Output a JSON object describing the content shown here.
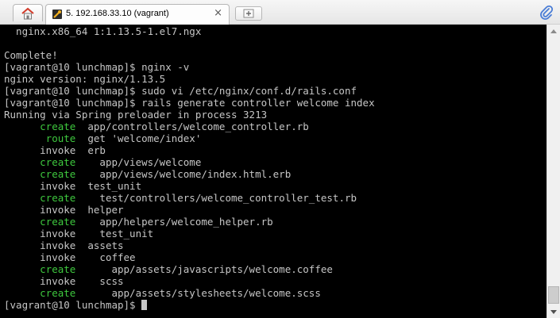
{
  "tabbar": {
    "home_icon": "home-icon",
    "tab_title": "5. 192.168.33.10 (vagrant)",
    "tab_icon": "tools-icon",
    "close_glyph": "×",
    "new_tab_icon": "new-tab-icon",
    "attach_icon": "paperclip-icon"
  },
  "terminal": {
    "lines": [
      {
        "text": "  nginx.x86_64 1:1.13.5-1.el7.ngx"
      },
      {
        "text": ""
      },
      {
        "text": "Complete!"
      },
      {
        "text": "[vagrant@10 lunchmap]$ nginx -v"
      },
      {
        "text": "nginx version: nginx/1.13.5"
      },
      {
        "text": "[vagrant@10 lunchmap]$ sudo vi /etc/nginx/conf.d/rails.conf"
      },
      {
        "text": "[vagrant@10 lunchmap]$ rails generate controller welcome index"
      },
      {
        "text": "Running via Spring preloader in process 3213"
      },
      {
        "action": "      create",
        "text": "  app/controllers/welcome_controller.rb"
      },
      {
        "action": "       route",
        "text": "  get 'welcome/index'"
      },
      {
        "action": "      invoke",
        "text": "  erb",
        "plain": true
      },
      {
        "action": "      create",
        "text": "    app/views/welcome"
      },
      {
        "action": "      create",
        "text": "    app/views/welcome/index.html.erb"
      },
      {
        "action": "      invoke",
        "text": "  test_unit",
        "plain": true
      },
      {
        "action": "      create",
        "text": "    test/controllers/welcome_controller_test.rb"
      },
      {
        "action": "      invoke",
        "text": "  helper",
        "plain": true
      },
      {
        "action": "      create",
        "text": "    app/helpers/welcome_helper.rb"
      },
      {
        "action": "      invoke",
        "text": "    test_unit",
        "plain": true
      },
      {
        "action": "      invoke",
        "text": "  assets",
        "plain": true
      },
      {
        "action": "      invoke",
        "text": "    coffee",
        "plain": true
      },
      {
        "action": "      create",
        "text": "      app/assets/javascripts/welcome.coffee"
      },
      {
        "action": "      invoke",
        "text": "    scss",
        "plain": true
      },
      {
        "action": "      create",
        "text": "      app/assets/stylesheets/welcome.scss"
      }
    ],
    "prompt": "[vagrant@10 lunchmap]$ "
  },
  "colors": {
    "background": "#000000",
    "text": "#c6c6c6",
    "action_green": "#3ec83e"
  }
}
